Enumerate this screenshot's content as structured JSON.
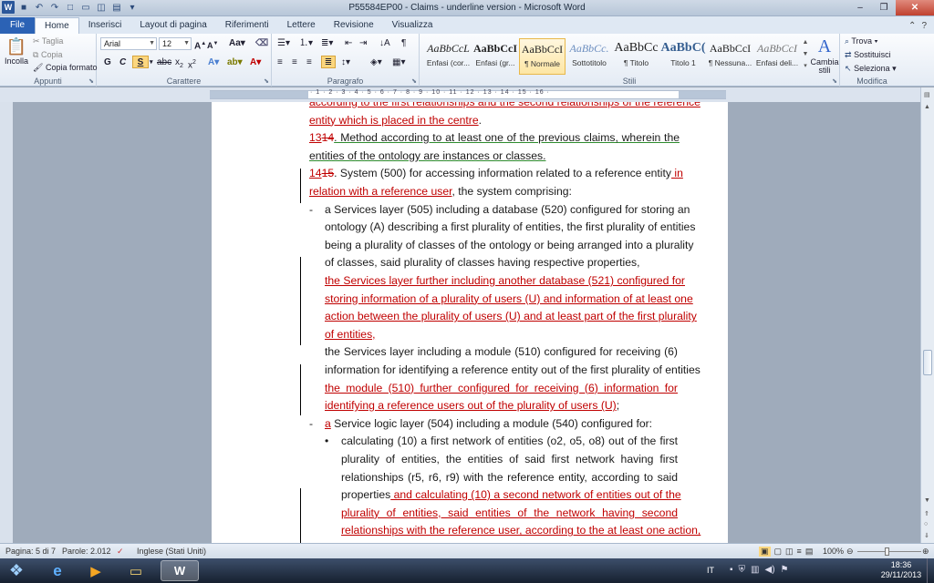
{
  "window": {
    "title": "P55584EP00 - Claims - underline version - Microsoft Word",
    "qat_icons": [
      "word-app-icon",
      "save-icon",
      "undo-icon",
      "redo-icon",
      "new-document-icon",
      "open-icon",
      "print-preview-icon",
      "quick-print-icon",
      "customize-qat-icon"
    ]
  },
  "tabs": [
    "File",
    "Home",
    "Inserisci",
    "Layout di pagina",
    "Riferimenti",
    "Lettere",
    "Revisione",
    "Visualizza"
  ],
  "active_tab": "Home",
  "ribbon": {
    "clipboard": {
      "paste": "Incolla",
      "cut": "Taglia",
      "copy": "Copia",
      "format_painter": "Copia formato",
      "label": "Appunti"
    },
    "font": {
      "name": "Arial",
      "size": "12",
      "label": "Carattere"
    },
    "paragraph": {
      "label": "Paragrafo"
    },
    "styles": {
      "label": "Stili",
      "items": [
        {
          "sample": "AaBbCcL",
          "name": "Enfasi (cor..."
        },
        {
          "sample": "AaBbCcI",
          "name": "Enfasi (gr..."
        },
        {
          "sample": "AaBbCcI",
          "name": "¶ Normale"
        },
        {
          "sample": "AaBbCc.",
          "name": "Sottotitolo"
        },
        {
          "sample": "AaBbCc",
          "name": "¶ Titolo"
        },
        {
          "sample": "AaBbC(",
          "name": "Titolo 1"
        },
        {
          "sample": "AaBbCcI",
          "name": "¶ Nessuna..."
        },
        {
          "sample": "AaBbCcI",
          "name": "Enfasi deli..."
        }
      ],
      "active_index": 2,
      "change_styles": "Cambia stili"
    },
    "editing": {
      "find": "Trova",
      "replace": "Sostituisci",
      "select": "Seleziona",
      "label": "Modifica"
    }
  },
  "document": {
    "lines": [
      {
        "parts": [
          {
            "t": "according to the first relationships and the second relationships of the reference",
            "s": "ins"
          }
        ],
        "cut": true
      },
      {
        "parts": [
          {
            "t": "entity which is placed in the centre",
            "s": "ins"
          },
          {
            "t": ".",
            "s": "n"
          }
        ]
      },
      {
        "parts": [
          {
            "t": "13",
            "s": "ins"
          },
          {
            "t": "14",
            "s": "del"
          },
          {
            "t": ".  Method according to at least one of the previous claims, wherein the",
            "s": "g"
          }
        ]
      },
      {
        "parts": [
          {
            "t": "entities of the ontology are instances or classes.",
            "s": "g"
          }
        ]
      },
      {
        "parts": [
          {
            "t": "14",
            "s": "ins"
          },
          {
            "t": "15",
            "s": "del"
          },
          {
            "t": ". System (500) for accessing information related to a reference entity",
            "s": "n"
          },
          {
            "t": " in",
            "s": "ins"
          }
        ]
      },
      {
        "parts": [
          {
            "t": "relation with a reference user",
            "s": "ins"
          },
          {
            "t": ", the system comprising:",
            "s": "n"
          }
        ]
      },
      {
        "parts": [
          {
            "t": "a Services layer (505) including a database (520) configured for storing an",
            "s": "n"
          }
        ],
        "bullet": "-"
      },
      {
        "parts": [
          {
            "t": "ontology (A) describing a first plurality of entities, the first plurality of entities",
            "s": "n"
          }
        ]
      },
      {
        "parts": [
          {
            "t": "being a plurality of classes of the ontology or being arranged into a plurality",
            "s": "n"
          }
        ]
      },
      {
        "parts": [
          {
            "t": "of classes, said plurality of classes having respective properties,",
            "s": "n"
          }
        ]
      },
      {
        "parts": [
          {
            "t": "the Services layer further including another database (521) configured for",
            "s": "ins"
          }
        ]
      },
      {
        "parts": [
          {
            "t": "storing information of a plurality of users (U) and information of at least one",
            "s": "ins"
          }
        ]
      },
      {
        "parts": [
          {
            "t": "action between the plurality of users (U) and at least part of the first plurality",
            "s": "ins"
          }
        ]
      },
      {
        "parts": [
          {
            "t": "of entities,",
            "s": "ins"
          }
        ]
      },
      {
        "parts": [
          {
            "t": "the Services layer including a module (510) configured for receiving (6)",
            "s": "n"
          }
        ]
      },
      {
        "parts": [
          {
            "t": "information for identifying a reference entity out of the first plurality of entities",
            "s": "n"
          }
        ]
      },
      {
        "parts": [
          {
            "t": "the module (510) further configured for receiving (6) information for",
            "s": "ins"
          }
        ]
      },
      {
        "parts": [
          {
            "t": "identifying a reference users out of the plurality of users (U)",
            "s": "ins"
          },
          {
            "t": ";",
            "s": "n"
          }
        ]
      },
      {
        "parts": [
          {
            "t": "a",
            "s": "ins"
          },
          {
            "t": " Service logic layer (504) including a module (540) configured for:",
            "s": "n"
          }
        ],
        "bullet": "-"
      },
      {
        "parts": [
          {
            "t": "calculating (10) a first network of entities (o2, o5, o8) out of the first",
            "s": "n"
          }
        ],
        "bullet": "•"
      },
      {
        "parts": [
          {
            "t": "plurality of entities, the entities of said first network having first",
            "s": "n"
          }
        ]
      },
      {
        "parts": [
          {
            "t": "relationships (r5, r6, r9) with the reference entity, according to said",
            "s": "n"
          }
        ]
      },
      {
        "parts": [
          {
            "t": "properties",
            "s": "n"
          },
          {
            "t": " and calculating (10) a second network of entities out of the",
            "s": "ins"
          }
        ]
      },
      {
        "parts": [
          {
            "t": "plurality of entities, said entities of the network having second",
            "s": "ins"
          }
        ]
      },
      {
        "parts": [
          {
            "t": "relationships with the reference user, according to the at least one action,",
            "s": "ins"
          }
        ]
      }
    ]
  },
  "status": {
    "page": "Pagina: 5 di 7",
    "words": "Parole: 2.012",
    "language": "Inglese (Stati Uniti)",
    "zoom": "100%"
  },
  "taskbar": {
    "time": "18:36",
    "date": "29/11/2013",
    "lang": "IT"
  }
}
